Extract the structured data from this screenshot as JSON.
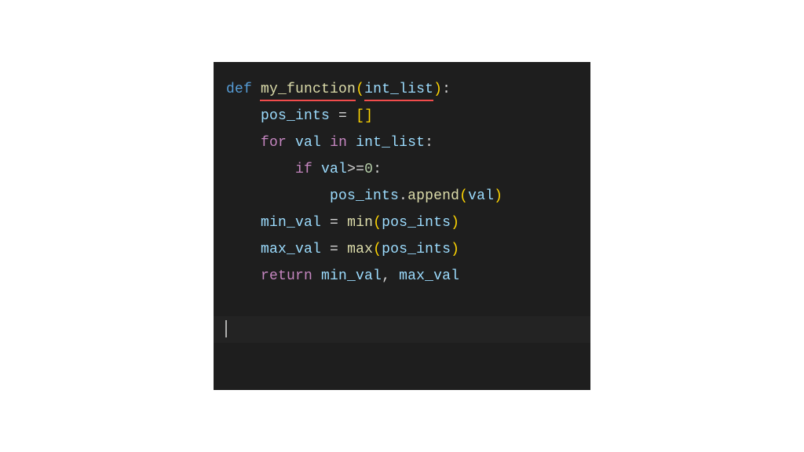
{
  "code": {
    "line1": {
      "kw_def": "def",
      "sp": " ",
      "fn": "my_function",
      "lp": "(",
      "param": "int_list",
      "rp": ")",
      "colon": ":"
    },
    "line2": {
      "indent": "    ",
      "var": "pos_ints",
      "sp1": " ",
      "eq": "=",
      "sp2": " ",
      "lb": "[",
      "rb": "]"
    },
    "line3": {
      "indent": "    ",
      "kw_for": "for",
      "sp1": " ",
      "var1": "val",
      "sp2": " ",
      "kw_in": "in",
      "sp3": " ",
      "var2": "int_list",
      "colon": ":"
    },
    "line4": {
      "indent": "        ",
      "kw_if": "if",
      "sp1": " ",
      "var": "val",
      "op": ">=",
      "num": "0",
      "colon": ":"
    },
    "line5": {
      "indent": "            ",
      "var": "pos_ints",
      "dot": ".",
      "fn": "append",
      "lp": "(",
      "arg": "val",
      "rp": ")"
    },
    "line6": {
      "indent": "    ",
      "var": "min_val",
      "sp1": " ",
      "eq": "=",
      "sp2": " ",
      "fn": "min",
      "lp": "(",
      "arg": "pos_ints",
      "rp": ")"
    },
    "line7": {
      "indent": "    ",
      "var": "max_val",
      "sp1": " ",
      "eq": "=",
      "sp2": " ",
      "fn": "max",
      "lp": "(",
      "arg": "pos_ints",
      "rp": ")"
    },
    "line8": {
      "indent": "    ",
      "kw": "return",
      "sp1": " ",
      "var1": "min_val",
      "comma": ",",
      "sp2": " ",
      "var2": "max_val"
    }
  }
}
